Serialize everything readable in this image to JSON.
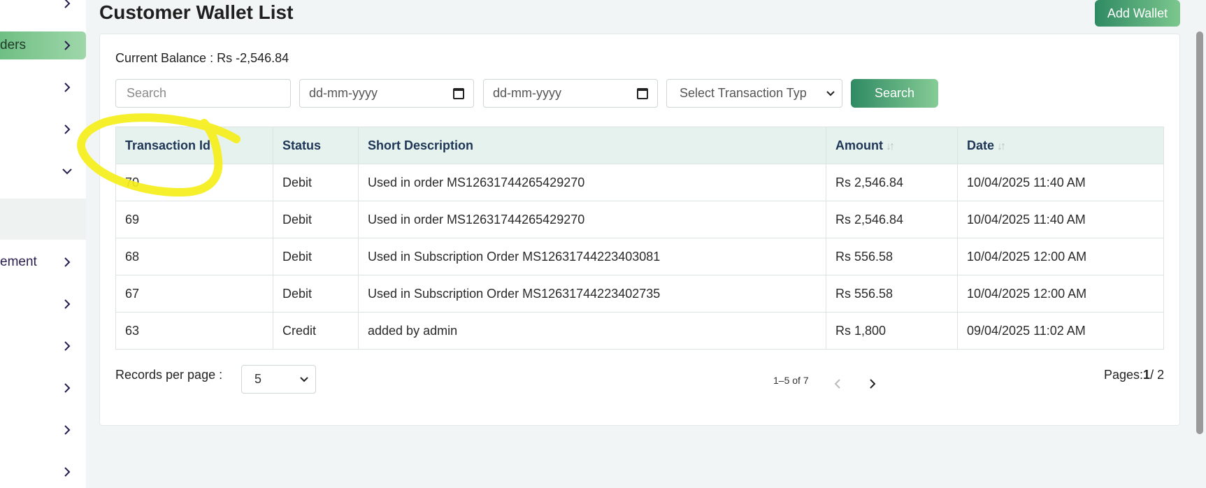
{
  "sidebar": {
    "items": [
      {
        "label": "",
        "chevron": "right"
      },
      {
        "label": "ders",
        "chevron": "right",
        "active": true
      },
      {
        "label": "",
        "chevron": "right"
      },
      {
        "label": "",
        "chevron": "right"
      },
      {
        "label": "",
        "chevron": "down"
      },
      {
        "label": "ement",
        "chevron": "right"
      },
      {
        "label": "",
        "chevron": "right"
      },
      {
        "label": "",
        "chevron": "right"
      },
      {
        "label": "",
        "chevron": "right"
      },
      {
        "label": "",
        "chevron": "right"
      },
      {
        "label": "",
        "chevron": "right"
      }
    ]
  },
  "header": {
    "title": "Customer Wallet List",
    "add_button": "Add Wallet"
  },
  "filters": {
    "balance_text": "Current Balance : Rs -2,546.84",
    "search_placeholder": "Search",
    "date_from": "dd-mm-yyyy",
    "date_to": "dd-mm-yyyy",
    "type_select": "Select Transaction Typ",
    "search_button": "Search"
  },
  "table": {
    "columns": [
      "Transaction Id",
      "Status",
      "Short Description",
      "Amount",
      "Date"
    ],
    "rows": [
      {
        "id": "70",
        "status": "Debit",
        "desc": "Used in order MS12631744265429270",
        "amount": "Rs 2,546.84",
        "date": "10/04/2025 11:40 AM"
      },
      {
        "id": "69",
        "status": "Debit",
        "desc": "Used in order MS12631744265429270",
        "amount": "Rs 2,546.84",
        "date": "10/04/2025 11:40 AM"
      },
      {
        "id": "68",
        "status": "Debit",
        "desc": "Used in Subscription Order MS12631744223403081",
        "amount": "Rs 556.58",
        "date": "10/04/2025 12:00 AM"
      },
      {
        "id": "67",
        "status": "Debit",
        "desc": "Used in Subscription Order MS12631744223402735",
        "amount": "Rs 556.58",
        "date": "10/04/2025 12:00 AM"
      },
      {
        "id": "63",
        "status": "Credit",
        "desc": "added by admin",
        "amount": "Rs 1,800",
        "date": "09/04/2025 11:02 AM"
      }
    ]
  },
  "pagination": {
    "records_label": "Records per page :",
    "records_value": "5",
    "range": "1–5 of 7",
    "pages_label": "Pages:",
    "current_page": "1",
    "total_pages": "/ 2"
  },
  "colors": {
    "accent": "#2f8a63",
    "annotation": "#f5ee1a"
  }
}
